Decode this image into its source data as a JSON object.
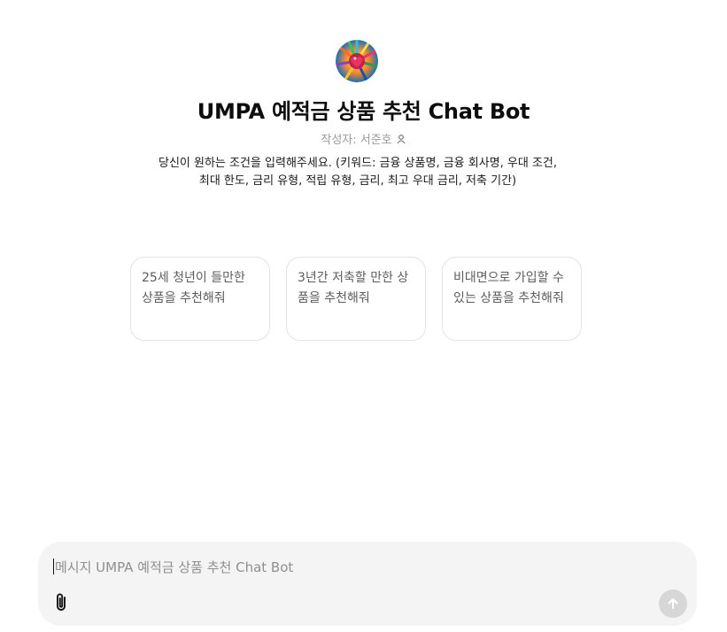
{
  "gpt": {
    "title": "UMPA 예적금 상품 추천 Chat Bot",
    "author": "작성자: 서준호",
    "description": "당신이 원하는 조건을 입력해주세요. (키워드: 금융 상품명, 금융 회사명, 우대 조건, 최대 한도, 금리 유형, 적립 유형, 금리, 최고 우대 금리, 저축 기간)"
  },
  "starters": [
    {
      "text": "25세 청년이 들만한 상품을 추천해줘"
    },
    {
      "text": "3년간 저축할 만한 상품을 추천해줘"
    },
    {
      "text": "비대면으로 가입할 수 있는 상품을 추천해줘"
    }
  ],
  "composer": {
    "placeholder": "메시지 UMPA 예적금 상품 추천 Chat Bot"
  },
  "icons": {
    "attach": "paperclip-icon",
    "send": "arrow-up-icon",
    "author": "person-icon"
  },
  "colors": {
    "composer_bg": "#f4f4f4",
    "send_disabled": "#d7d7d7"
  }
}
